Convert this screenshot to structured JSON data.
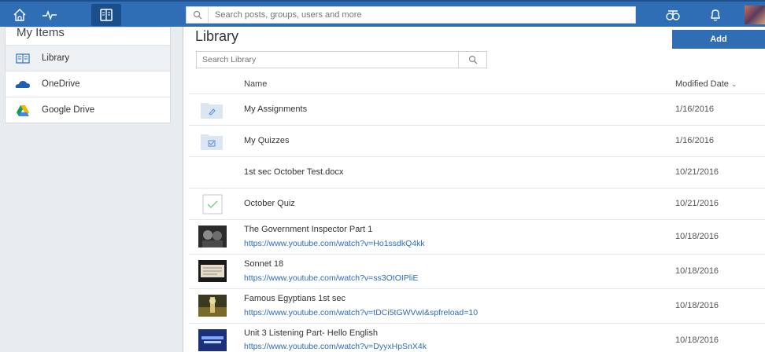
{
  "topbar": {
    "search_placeholder": "Search posts, groups, users and more",
    "nav_icons": [
      "home-icon",
      "activity-icon",
      "backpack-icon"
    ],
    "right_icons": [
      "network-icon",
      "bell-icon"
    ],
    "accent_color": "#2f6eb5"
  },
  "sidebar": {
    "title": "My Items",
    "items": [
      {
        "label": "Library",
        "icon": "book-icon",
        "selected": true
      },
      {
        "label": "OneDrive",
        "icon": "onedrive-icon"
      },
      {
        "label": "Google Drive",
        "icon": "google-drive-icon"
      }
    ]
  },
  "main": {
    "title": "Library",
    "add_label": "Add",
    "search_placeholder": "Search Library",
    "columns": {
      "name": "Name",
      "modified": "Modified Date"
    },
    "rows": [
      {
        "name": "My Assignments",
        "date": "1/16/2016",
        "icon": "assignment-folder-icon"
      },
      {
        "name": "My Quizzes",
        "date": "1/16/2016",
        "icon": "quiz-folder-icon"
      },
      {
        "name": "1st sec October Test.docx",
        "date": "10/21/2016",
        "icon": ""
      },
      {
        "name": "October Quiz",
        "date": "10/21/2016",
        "icon": "checkmark-icon"
      },
      {
        "name": "The Government Inspector Part 1",
        "link": "https://www.youtube.com/watch?v=Ho1ssdkQ4kk",
        "date": "10/18/2016",
        "icon": "video-thumbnail"
      },
      {
        "name": "Sonnet 18",
        "link": "https://www.youtube.com/watch?v=ss3OtOIPliE",
        "date": "10/18/2016",
        "icon": "video-thumbnail"
      },
      {
        "name": "Famous Egyptians 1st sec",
        "link": "https://www.youtube.com/watch?v=tDCi5tGWVwI&spfreload=10",
        "date": "10/18/2016",
        "icon": "video-thumbnail"
      },
      {
        "name": "Unit 3 Listening Part- Hello English",
        "link": "https://www.youtube.com/watch?v=DyyxHpSnX4k",
        "date": "10/18/2016",
        "icon": "video-thumbnail"
      }
    ]
  }
}
